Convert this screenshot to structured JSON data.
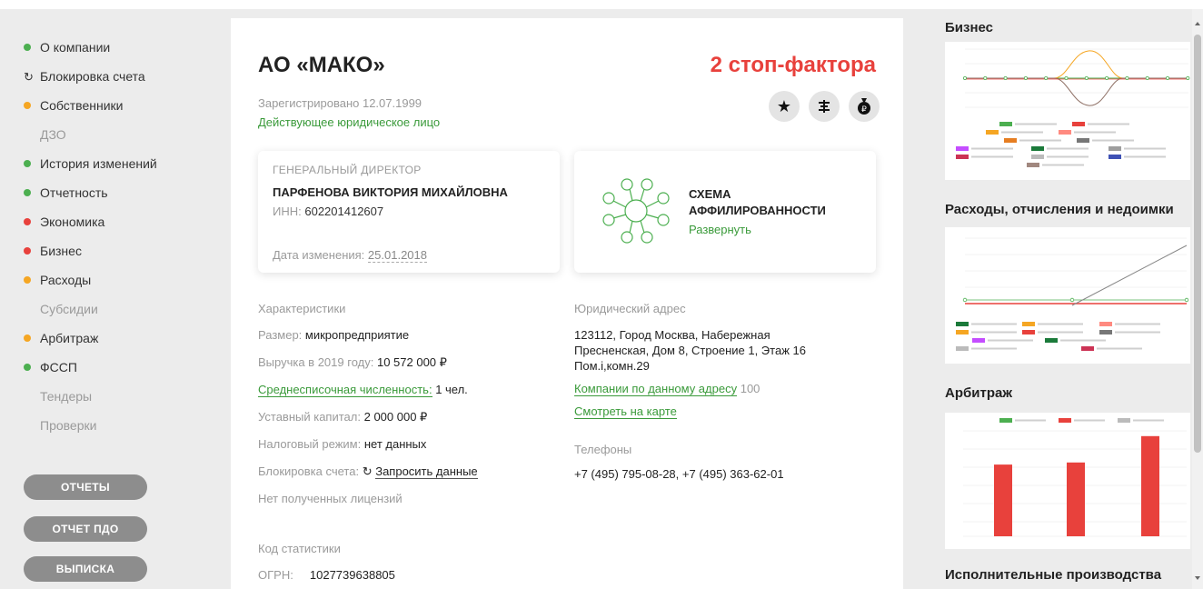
{
  "sidebar": {
    "items": [
      {
        "label": "О компании",
        "color": "#4caf50",
        "kind": "dot"
      },
      {
        "label": "Блокировка счета",
        "kind": "refresh"
      },
      {
        "label": "Собственники",
        "color": "#f5a623",
        "kind": "dot"
      },
      {
        "label": "ДЗО",
        "kind": "muted"
      },
      {
        "label": "История изменений",
        "color": "#4caf50",
        "kind": "dot"
      },
      {
        "label": "Отчетность",
        "color": "#4caf50",
        "kind": "dot"
      },
      {
        "label": "Экономика",
        "color": "#e8413c",
        "kind": "dot"
      },
      {
        "label": "Бизнес",
        "color": "#e8413c",
        "kind": "dot"
      },
      {
        "label": "Расходы",
        "color": "#f5a623",
        "kind": "dot"
      },
      {
        "label": "Субсидии",
        "kind": "muted"
      },
      {
        "label": "Арбитраж",
        "color": "#f5a623",
        "kind": "dot"
      },
      {
        "label": "ФССП",
        "color": "#4caf50",
        "kind": "dot"
      },
      {
        "label": "Тендеры",
        "kind": "muted"
      },
      {
        "label": "Проверки",
        "kind": "muted"
      }
    ],
    "buttons": {
      "reports": "ОТЧЕТЫ",
      "pdo": "ОТЧЕТ ПДО",
      "extract": "ВЫПИСКА"
    }
  },
  "company": {
    "name": "АО «МАКО»",
    "stop_factors": "2 стоп-фактора",
    "registered": "Зарегистрировано 12.07.1999",
    "status": "Действующее юридическое лицо"
  },
  "director": {
    "label": "ГЕНЕРАЛЬНЫЙ ДИРЕКТОР",
    "name": "ПАРФЕНОВА ВИКТОРИЯ МИХАЙЛОВНА",
    "inn_label": "ИНН:",
    "inn": "602201412607",
    "date_label": "Дата изменения:",
    "date": "25.01.2018"
  },
  "affiliation": {
    "title": "СХЕМА АФФИЛИРОВАННОСТИ",
    "link": "Развернуть"
  },
  "characteristics": {
    "title": "Характеристики",
    "size_label": "Размер:",
    "size": "микропредприятие",
    "revenue_label": "Выручка в 2019 году:",
    "revenue": "10 572 000 ₽",
    "headcount_label": "Среднесписочная численность:",
    "headcount": "1 чел.",
    "capital_label": "Уставный капитал:",
    "capital": "2 000 000 ₽",
    "tax_label": "Налоговый режим:",
    "tax": "нет данных",
    "block_label": "Блокировка счета:",
    "block_link": "Запросить данные",
    "licenses": "Нет полученных лицензий"
  },
  "stats": {
    "title": "Код статистики",
    "ogrn_label": "ОГРН:",
    "ogrn": "1027739638805"
  },
  "address": {
    "title": "Юридический адрес",
    "line1": "123112, Город Москва, Набережная",
    "line2": "Пресненская, Дом 8, Строение 1, Этаж 16",
    "line3": "Пом.i,комн.29",
    "companies_link": "Компании по данному адресу",
    "companies_count": "100",
    "map_link": "Смотреть на карте"
  },
  "phones": {
    "title": "Телефоны",
    "value": "+7 (495) 795-08-28, +7 (495) 363-62-01"
  },
  "right_panel": {
    "business_title": "Бизнес",
    "expenses_title": "Расходы, отчисления и недоимки",
    "arbitrage_title": "Арбитраж",
    "enforcement_title": "Исполнительные производства"
  },
  "colors": {
    "green": "#3a9a3a",
    "red": "#e8413c",
    "orange": "#f5a623",
    "button_gray": "#8d8d8d"
  },
  "chart_data": [
    {
      "type": "line",
      "title": "Бизнес",
      "series": [
        {
          "color": "#4caf50"
        },
        {
          "color": "#e8413c"
        },
        {
          "color": "#f5a623"
        },
        {
          "color": "#8d6e63"
        }
      ]
    },
    {
      "type": "line",
      "title": "Расходы, отчисления и недоимки",
      "series": [
        {
          "color": "#4caf50"
        },
        {
          "color": "#e8413c"
        },
        {
          "color": "#888888"
        }
      ]
    },
    {
      "type": "bar",
      "title": "Арбитраж",
      "series": [
        {
          "color": "#e8413c",
          "values": [
            0.68,
            0.7,
            0.95
          ]
        }
      ]
    }
  ]
}
